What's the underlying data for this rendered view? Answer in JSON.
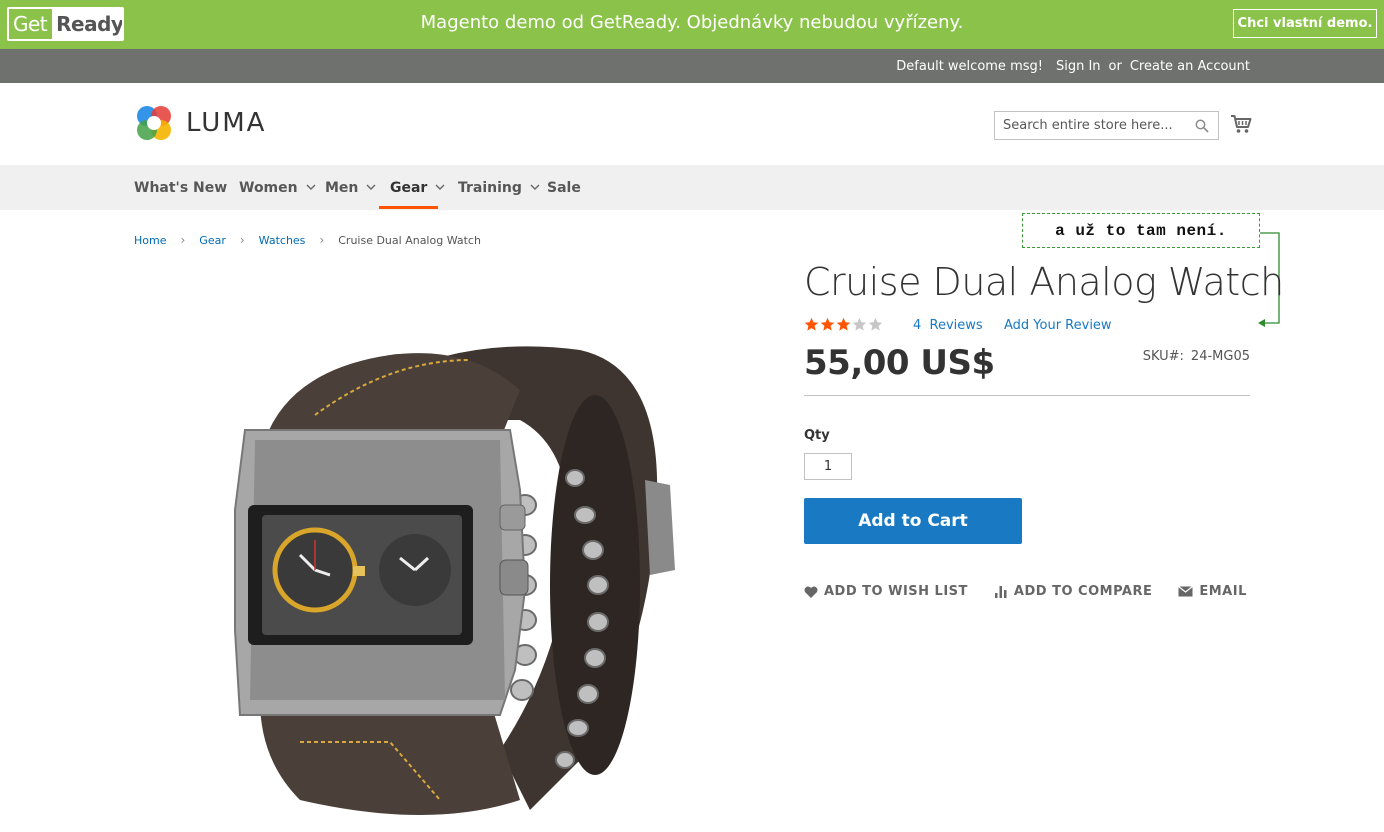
{
  "promo": {
    "logo_get": "Get",
    "logo_ready": "Ready",
    "message": "Magento demo od GetReady. Objednávky nebudou vyřízeny.",
    "button": "Chci vlastní demo."
  },
  "panel": {
    "welcome": "Default welcome msg!",
    "sign_in": "Sign In",
    "or": "or",
    "create_account": "Create an Account"
  },
  "header": {
    "logo_text": "LUMA",
    "search_placeholder": "Search entire store here..."
  },
  "nav": {
    "items": [
      {
        "label": "What's New",
        "has_dropdown": false
      },
      {
        "label": "Women",
        "has_dropdown": true
      },
      {
        "label": "Men",
        "has_dropdown": true
      },
      {
        "label": "Gear",
        "has_dropdown": true,
        "active": true
      },
      {
        "label": "Training",
        "has_dropdown": true
      },
      {
        "label": "Sale",
        "has_dropdown": false
      }
    ],
    "active_color": "#ff5501"
  },
  "breadcrumb": {
    "items": [
      "Home",
      "Gear",
      "Watches"
    ],
    "current": "Cruise Dual Analog Watch",
    "separator": "›"
  },
  "annotation": {
    "text": "a už to tam není."
  },
  "product": {
    "title": "Cruise Dual Analog Watch",
    "rating": 3,
    "rating_max": 5,
    "reviews_count": "4",
    "reviews_label": "Reviews",
    "add_review": "Add Your Review",
    "price": "55,00 US$",
    "sku_label": "SKU#:",
    "sku": "24-MG05",
    "qty_label": "Qty",
    "qty_value": "1",
    "add_to_cart": "Add to Cart",
    "actions": {
      "wishlist": "ADD TO WISH LIST",
      "compare": "ADD TO COMPARE",
      "email": "EMAIL"
    }
  },
  "colors": {
    "promo_green": "#8bc34a",
    "panel_gray": "#6e716e",
    "link_blue": "#1979c3",
    "button_blue": "#1979c3",
    "star_orange": "#ff5501"
  }
}
